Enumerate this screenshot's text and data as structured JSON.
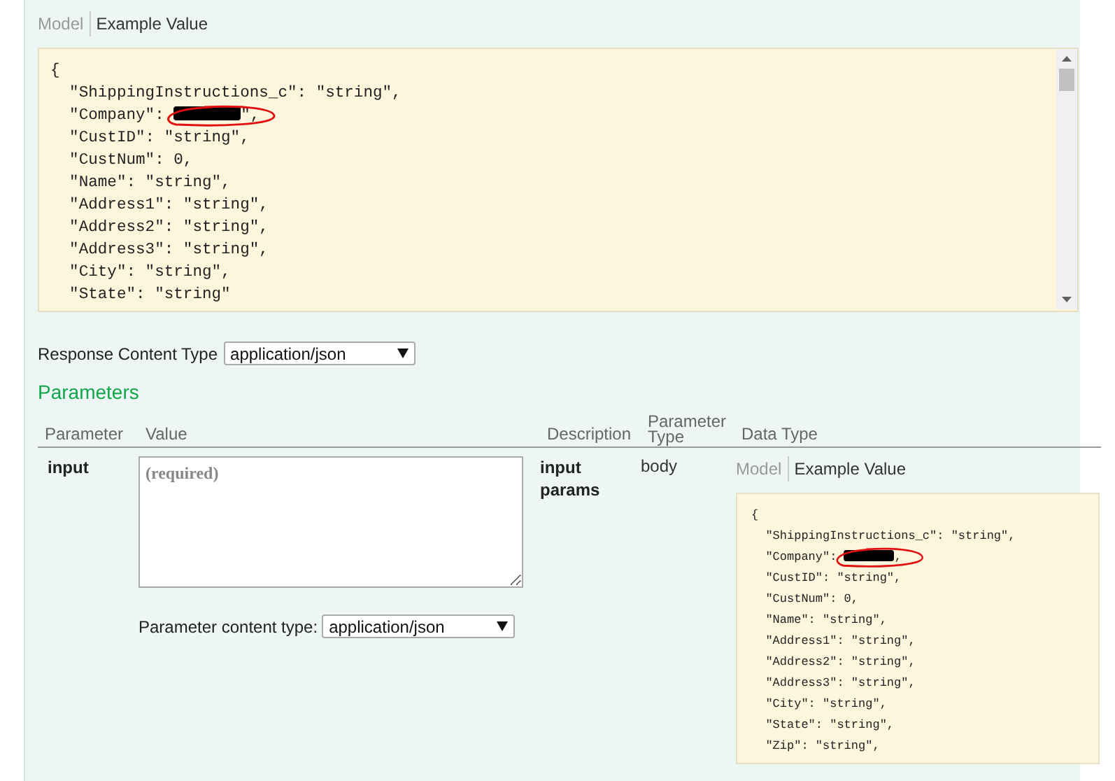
{
  "example_tabs": [
    {
      "label": "Model",
      "selected": false
    },
    {
      "label": "Example Value",
      "selected": true
    }
  ],
  "example_code": [
    {
      "kind": "text",
      "text": "{"
    },
    {
      "kind": "text",
      "text": "  \"ShippingInstructions_c\": \"string\","
    },
    {
      "kind": "redacted",
      "before": "  \"Company\": ",
      "after": "\",",
      "annotated": true
    },
    {
      "kind": "text",
      "text": "  \"CustID\": \"string\","
    },
    {
      "kind": "text",
      "text": "  \"CustNum\": 0,"
    },
    {
      "kind": "text",
      "text": "  \"Name\": \"string\","
    },
    {
      "kind": "text",
      "text": "  \"Address1\": \"string\","
    },
    {
      "kind": "text",
      "text": "  \"Address2\": \"string\","
    },
    {
      "kind": "text",
      "text": "  \"Address3\": \"string\","
    },
    {
      "kind": "text",
      "text": "  \"City\": \"string\","
    },
    {
      "kind": "text",
      "text": "  \"State\": \"string\""
    }
  ],
  "response_content_type": {
    "label": "Response Content Type",
    "value": "application/json"
  },
  "parameters": {
    "title": "Parameters",
    "columns": [
      "Parameter",
      "Value",
      "Description",
      "Parameter Type",
      "Data Type"
    ],
    "rows": [
      {
        "name": "input",
        "placeholder": "(required)",
        "content_type_label": "Parameter content type:",
        "content_type": "application/json",
        "description": "input params",
        "parameter_type": "body",
        "data_type_tabs": [
          {
            "label": "Model",
            "selected": false
          },
          {
            "label": "Example Value",
            "selected": true
          }
        ],
        "example_code": [
          {
            "kind": "text",
            "text": "{"
          },
          {
            "kind": "text",
            "text": "  \"ShippingInstructions_c\": \"string\","
          },
          {
            "kind": "redacted",
            "before": "  \"Company\": ",
            "after": ",",
            "annotated": true
          },
          {
            "kind": "text",
            "text": "  \"CustID\": \"string\","
          },
          {
            "kind": "text",
            "text": "  \"CustNum\": 0,"
          },
          {
            "kind": "text",
            "text": "  \"Name\": \"string\","
          },
          {
            "kind": "text",
            "text": "  \"Address1\": \"string\","
          },
          {
            "kind": "text",
            "text": "  \"Address2\": \"string\","
          },
          {
            "kind": "text",
            "text": "  \"Address3\": \"string\","
          },
          {
            "kind": "text",
            "text": "  \"City\": \"string\","
          },
          {
            "kind": "text",
            "text": "  \"State\": \"string\","
          },
          {
            "kind": "text",
            "text": "  \"Zip\": \"string\","
          }
        ]
      }
    ]
  }
}
